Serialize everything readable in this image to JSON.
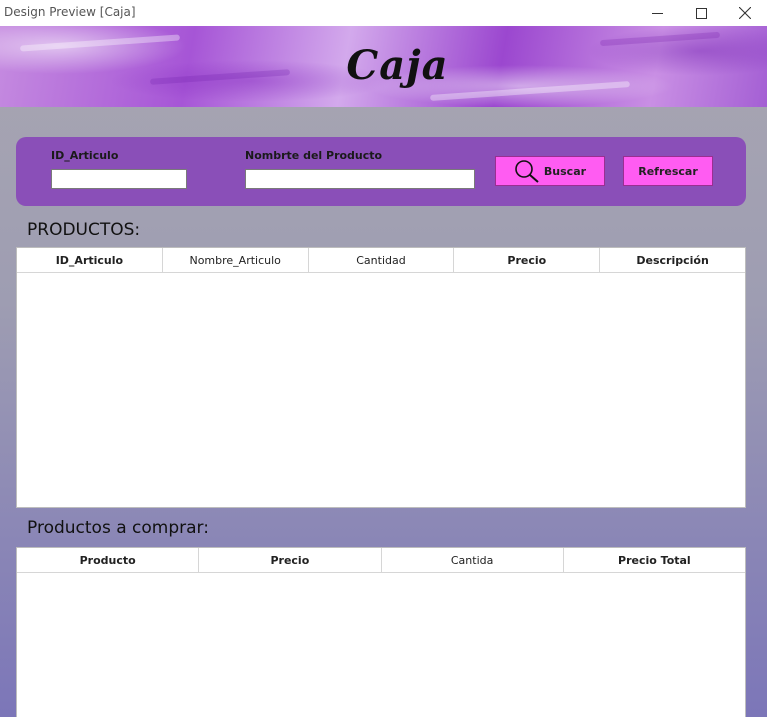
{
  "window": {
    "title": "Design Preview [Caja]",
    "controls": [
      "minimize-icon",
      "maximize-icon",
      "close-icon"
    ]
  },
  "banner": {
    "title": "Caja"
  },
  "search": {
    "id_label": "ID_Articulo",
    "id_value": "",
    "name_label": "Nombrte del Producto",
    "name_value": "",
    "search_button": "Buscar",
    "search_icon": "magnifier-icon",
    "refresh_button": "Refrescar"
  },
  "products": {
    "title": "PRODUCTOS:",
    "columns": [
      "ID_Articulo",
      "Nombre_Articulo",
      "Cantidad",
      "Precio",
      "Descripción"
    ],
    "rows": []
  },
  "cart": {
    "title": "Productos a comprar:",
    "columns": [
      "Producto",
      "Precio",
      "Cantida",
      "Precio Total"
    ],
    "rows": []
  },
  "colors": {
    "panel": "#8a4fb8",
    "button": "#ff5cf2",
    "background_top": "#a8a6b1",
    "background_bottom": "#7c76b8"
  }
}
